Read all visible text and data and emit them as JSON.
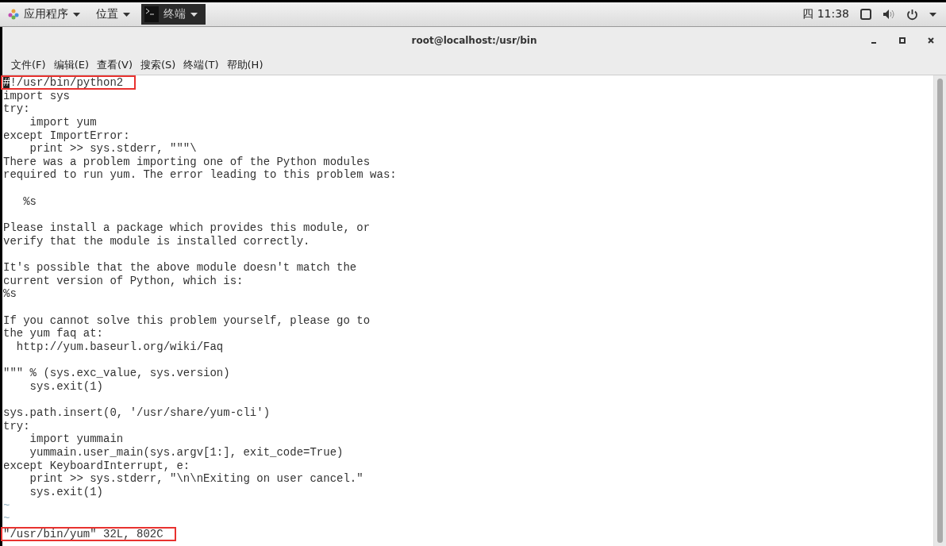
{
  "top_panel": {
    "menus": [
      {
        "label": "应用程序",
        "kind": "apps"
      },
      {
        "label": "位置",
        "kind": "plain"
      },
      {
        "label": "终端",
        "kind": "app"
      }
    ],
    "clock": "四 11:38"
  },
  "window": {
    "title": "root@localhost:/usr/bin"
  },
  "menu_bar": [
    "文件(F)",
    "编辑(E)",
    "查看(V)",
    "搜索(S)",
    "终端(T)",
    "帮助(H)"
  ],
  "editor": {
    "lines": [
      {
        "kind": "code",
        "text": "#!/usr/bin/python2",
        "cursor": true,
        "highlighted": true
      },
      {
        "kind": "code",
        "text": "import sys"
      },
      {
        "kind": "code",
        "text": "try:"
      },
      {
        "kind": "code",
        "text": "    import yum"
      },
      {
        "kind": "code",
        "text": "except ImportError:"
      },
      {
        "kind": "code",
        "text": "    print >> sys.stderr, \"\"\"\\"
      },
      {
        "kind": "code",
        "text": "There was a problem importing one of the Python modules"
      },
      {
        "kind": "code",
        "text": "required to run yum. The error leading to this problem was:"
      },
      {
        "kind": "blank"
      },
      {
        "kind": "code",
        "text": "   %s"
      },
      {
        "kind": "blank"
      },
      {
        "kind": "code",
        "text": "Please install a package which provides this module, or"
      },
      {
        "kind": "code",
        "text": "verify that the module is installed correctly."
      },
      {
        "kind": "blank"
      },
      {
        "kind": "code",
        "text": "It's possible that the above module doesn't match the"
      },
      {
        "kind": "code",
        "text": "current version of Python, which is:"
      },
      {
        "kind": "code",
        "text": "%s"
      },
      {
        "kind": "blank"
      },
      {
        "kind": "code",
        "text": "If you cannot solve this problem yourself, please go to"
      },
      {
        "kind": "code",
        "text": "the yum faq at:"
      },
      {
        "kind": "code",
        "text": "  http://yum.baseurl.org/wiki/Faq"
      },
      {
        "kind": "blank"
      },
      {
        "kind": "code",
        "text": "\"\"\" % (sys.exc_value, sys.version)"
      },
      {
        "kind": "code",
        "text": "    sys.exit(1)"
      },
      {
        "kind": "blank"
      },
      {
        "kind": "code",
        "text": "sys.path.insert(0, '/usr/share/yum-cli')"
      },
      {
        "kind": "code",
        "text": "try:"
      },
      {
        "kind": "code",
        "text": "    import yummain"
      },
      {
        "kind": "code",
        "text": "    yummain.user_main(sys.argv[1:], exit_code=True)"
      },
      {
        "kind": "code",
        "text": "except KeyboardInterrupt, e:"
      },
      {
        "kind": "code",
        "text": "    print >> sys.stderr, \"\\n\\nExiting on user cancel.\""
      },
      {
        "kind": "code",
        "text": "    sys.exit(1)"
      },
      {
        "kind": "tilde",
        "text": "~"
      },
      {
        "kind": "tilde",
        "text": "~"
      }
    ],
    "status": {
      "text": "\"/usr/bin/yum\" 32L, 802C",
      "highlighted": true
    }
  }
}
